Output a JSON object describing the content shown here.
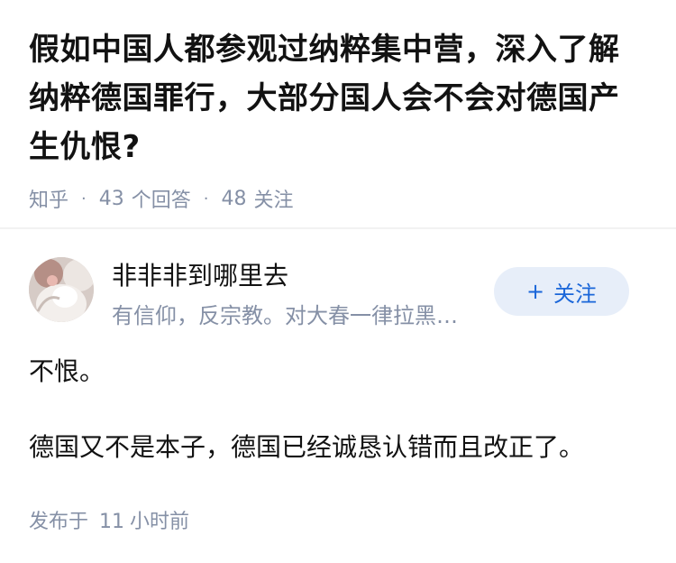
{
  "question": {
    "title": "假如中国人都参观过纳粹集中营，深入了解纳粹德国罪行，大部分国人会不会对德国产生仇恨?",
    "source": "知乎",
    "separator": "·",
    "answer_count": "43",
    "answer_label": "个回答",
    "follow_count": "48",
    "follow_label": "关注"
  },
  "answer": {
    "author": {
      "name": "非非非到哪里去",
      "bio": "有信仰，反宗教。对大春一律拉黑…",
      "avatar_icon": "avatar-photo",
      "follow_button": {
        "icon": "+",
        "label": "关注"
      }
    },
    "paragraphs": [
      "不恨。",
      "德国又不是本子，德国已经诚恳认错而且改正了。"
    ],
    "published_label": "发布于",
    "published_value": "11",
    "published_unit": "小时前"
  },
  "colors": {
    "title": "#121212",
    "meta": "#8590a6",
    "button_bg": "#e7eef9",
    "button_text": "#1a66d9"
  }
}
